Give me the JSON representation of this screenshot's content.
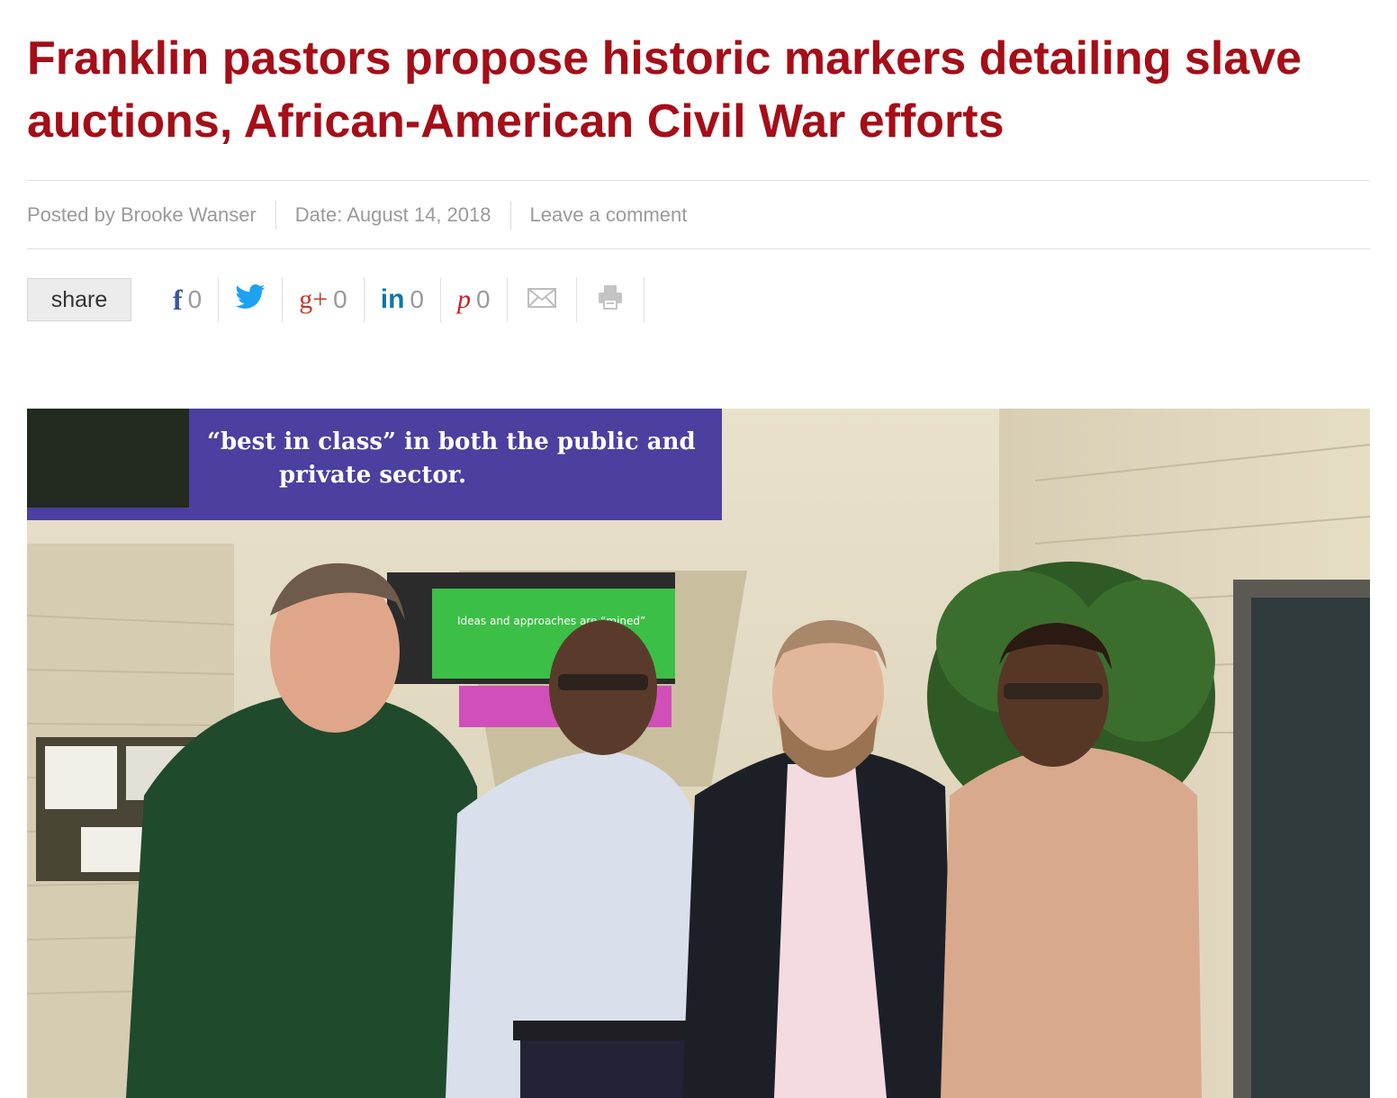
{
  "article": {
    "title": "Franklin pastors propose historic markers detailing slave auctions, African-American Civil War efforts",
    "meta": {
      "author": "Posted by Brooke Wanser",
      "date": "Date: August 14, 2018",
      "comment_link": "Leave a comment"
    }
  },
  "share": {
    "label": "share",
    "buttons": [
      {
        "network": "facebook",
        "icon": "facebook-icon",
        "glyph": "f",
        "count": "0"
      },
      {
        "network": "twitter",
        "icon": "twitter-icon",
        "glyph": "",
        "count": ""
      },
      {
        "network": "google-plus",
        "icon": "google-plus-icon",
        "glyph": "g+",
        "count": "0"
      },
      {
        "network": "linkedin",
        "icon": "linkedin-icon",
        "glyph": "in",
        "count": "0"
      },
      {
        "network": "pinterest",
        "icon": "pinterest-icon",
        "glyph": "p",
        "count": "0"
      },
      {
        "network": "email",
        "icon": "email-icon",
        "glyph": "",
        "count": ""
      },
      {
        "network": "print",
        "icon": "print-icon",
        "glyph": "",
        "count": ""
      }
    ]
  },
  "photo": {
    "banner_line1": "“best in class” in both the public and",
    "banner_line2": "private sector.",
    "sign_text": "Ideas and approaches are “mined”"
  },
  "colors": {
    "title": "#a50e18",
    "meta_text": "#9a9a9a",
    "facebook": "#3b5998",
    "twitter": "#1da1f2",
    "google_plus": "#c1392b",
    "linkedin": "#0e76a8",
    "pinterest": "#cb2027"
  }
}
